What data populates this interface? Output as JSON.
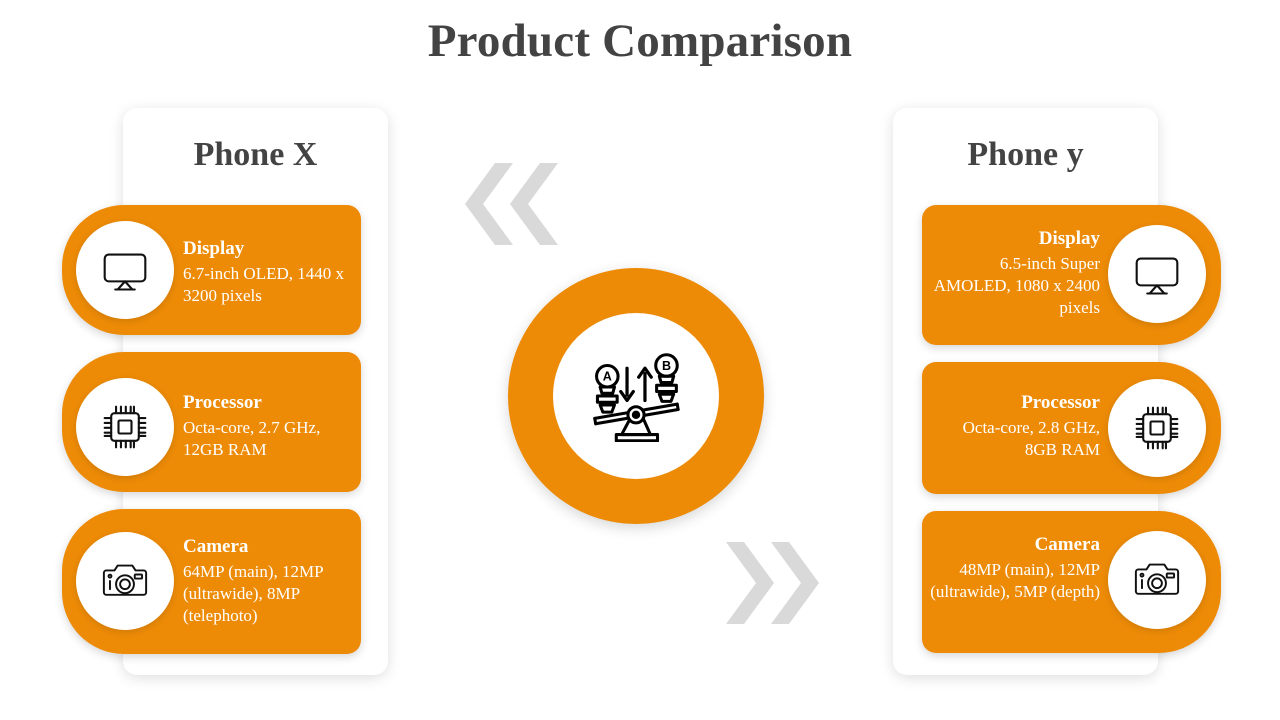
{
  "page": {
    "title": "Product Comparison",
    "background_color": "#ffffff",
    "accent_color": "#ED8B07",
    "title_color": "#434343",
    "chevron_color": "#d9d9d9"
  },
  "center_badge": {
    "icon": "balance-seesaw-icon",
    "label_a": "A",
    "label_b": "B"
  },
  "decorations": {
    "left_chevrons": "chevron-double-left-icon",
    "right_chevrons": "chevron-double-right-icon"
  },
  "products": [
    {
      "name": "Phone X",
      "side": "left",
      "features": [
        {
          "icon": "monitor-display-icon",
          "name": "Display",
          "spec": " 6.7-inch OLED, 1440 x 3200 pixels"
        },
        {
          "icon": "cpu-chip-icon",
          "name": "Processor",
          "spec": "Octa-core, 2.7 GHz, 12GB RAM"
        },
        {
          "icon": "camera-icon",
          "name": "Camera",
          "spec": " 64MP (main), 12MP (ultrawide), 8MP (telephoto)"
        }
      ]
    },
    {
      "name": "Phone y",
      "side": "right",
      "features": [
        {
          "icon": "monitor-display-icon",
          "name": "Display",
          "spec": "6.5-inch Super AMOLED, 1080 x 2400 pixels"
        },
        {
          "icon": "cpu-chip-icon",
          "name": "Processor",
          "spec": "Octa-core, 2.8 GHz,  8GB RAM"
        },
        {
          "icon": "camera-icon",
          "name": "Camera",
          "spec": "48MP (main), 12MP (ultrawide), 5MP (depth)"
        }
      ]
    }
  ]
}
